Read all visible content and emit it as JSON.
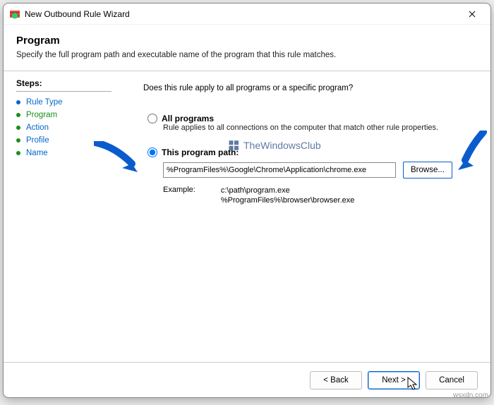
{
  "window": {
    "title": "New Outbound Rule Wizard"
  },
  "header": {
    "title": "Program",
    "subtitle": "Specify the full program path and executable name of the program that this rule matches."
  },
  "steps": {
    "title": "Steps:",
    "items": [
      {
        "label": "Rule Type",
        "state": "done"
      },
      {
        "label": "Program",
        "state": "current"
      },
      {
        "label": "Action",
        "state": "pending"
      },
      {
        "label": "Profile",
        "state": "pending"
      },
      {
        "label": "Name",
        "state": "pending"
      }
    ]
  },
  "content": {
    "question": "Does this rule apply to all programs or a specific program?",
    "opt_all": {
      "label": "All programs",
      "desc": "Rule applies to all connections on the computer that match other rule properties."
    },
    "opt_path": {
      "label": "This program path:",
      "value": "%ProgramFiles%\\Google\\Chrome\\Application\\chrome.exe",
      "browse": "Browse..."
    },
    "example": {
      "label": "Example:",
      "line1": "c:\\path\\program.exe",
      "line2": "%ProgramFiles%\\browser\\browser.exe"
    },
    "watermark": "TheWindowsClub"
  },
  "footer": {
    "back": "< Back",
    "next": "Next >",
    "cancel": "Cancel"
  },
  "source": "wsxdn.com"
}
